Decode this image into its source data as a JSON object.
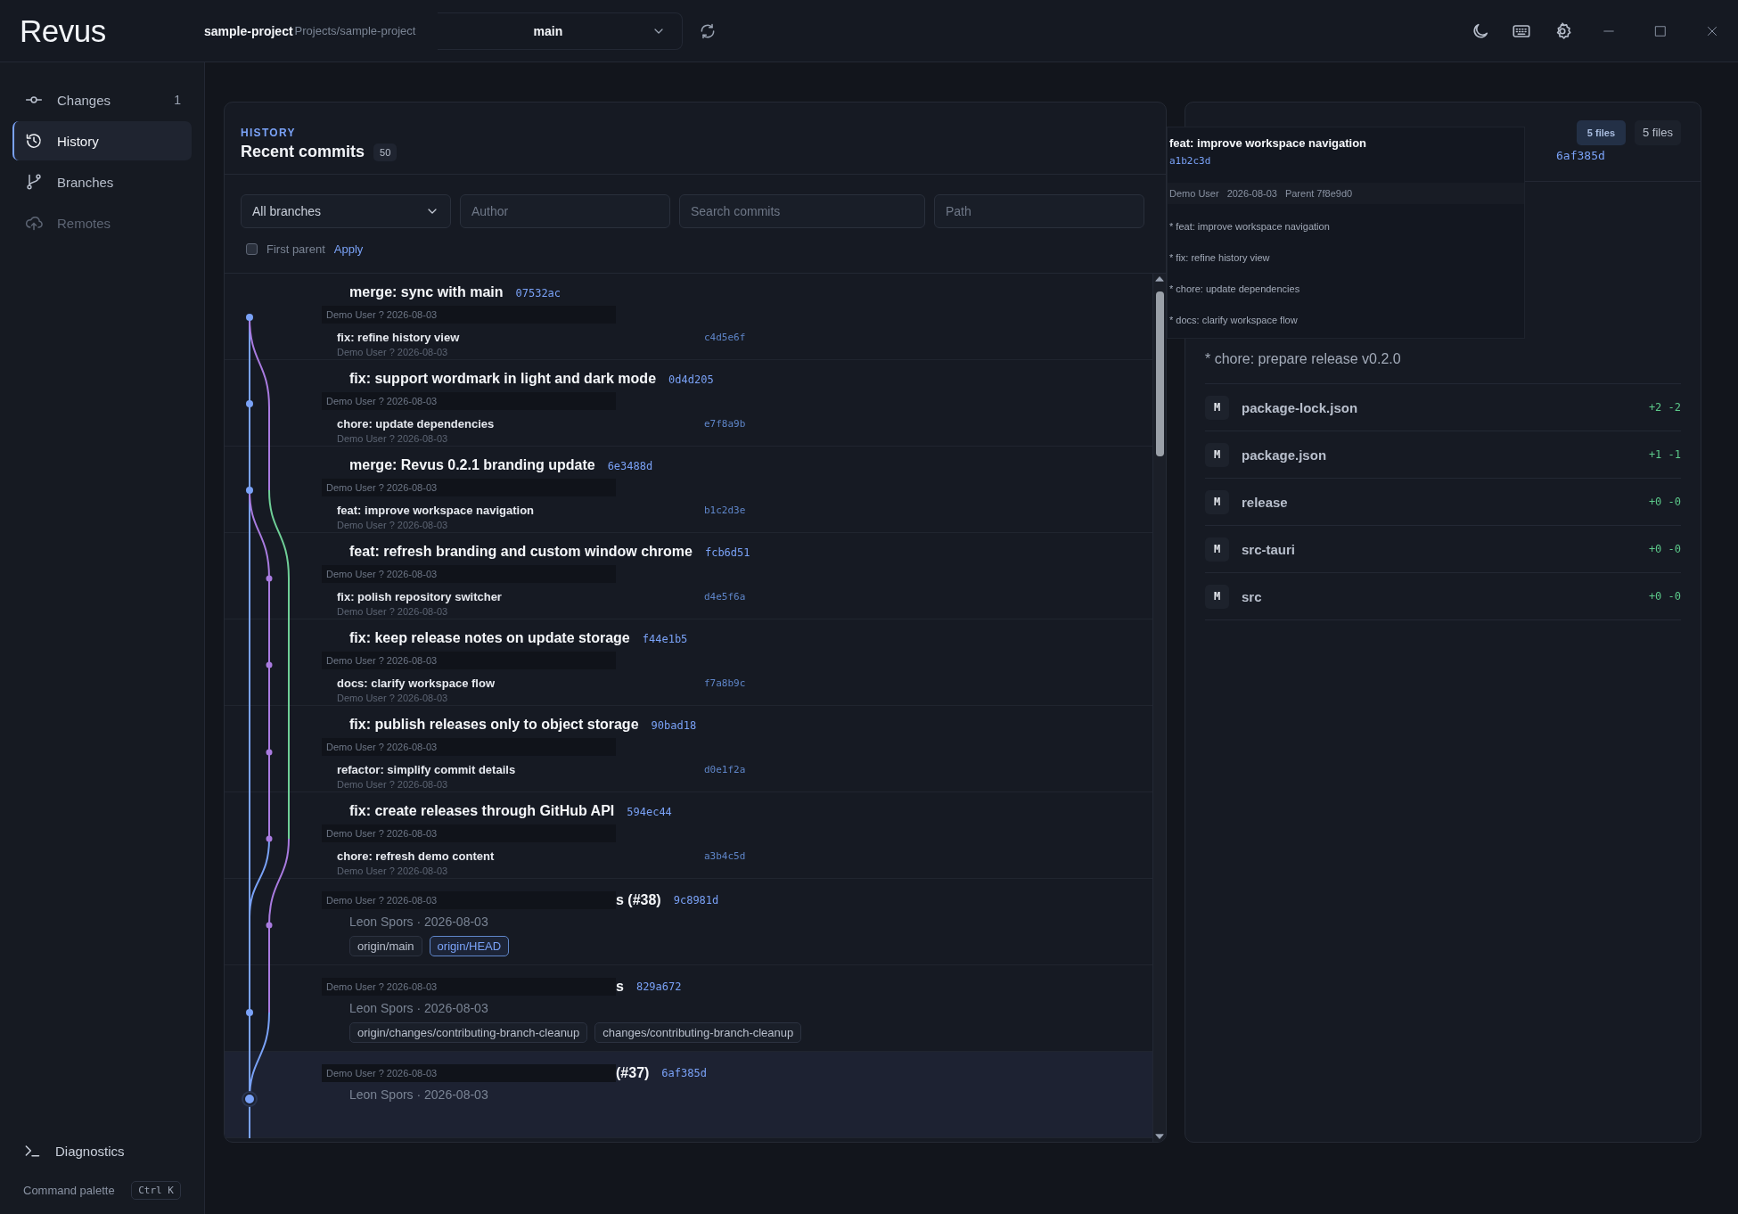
{
  "window": {
    "logo": "Revus",
    "repo_name": "sample-project",
    "repo_path": "Projects/sample-project",
    "branch": "main"
  },
  "sidebar": {
    "items": [
      {
        "label": "Changes",
        "count": "1",
        "selected": false,
        "disabled": false
      },
      {
        "label": "History",
        "selected": true,
        "disabled": false
      },
      {
        "label": "Branches",
        "selected": false,
        "disabled": false
      },
      {
        "label": "Remotes",
        "selected": false,
        "disabled": true
      }
    ],
    "diagnostics": "Diagnostics",
    "command_palette": "Command palette",
    "shortcut": "Ctrl K"
  },
  "history": {
    "eyebrow": "HISTORY",
    "title": "Recent commits",
    "count": "50",
    "branch_filter": "All branches",
    "author_placeholder": "Author",
    "search_placeholder": "Search commits",
    "path_placeholder": "Path",
    "first_parent": {
      "label": "First parent",
      "checked": false
    },
    "apply": "Apply",
    "commits": [
      {
        "kind": "full",
        "title": "merge: sync with main",
        "hash": "07532ac",
        "meta": "Demo User ? 2026-08-03",
        "selected": false,
        "sub": {
          "title": "fix: refine history view",
          "hash": "c4d5e6f",
          "meta": "Demo User ? 2026-08-03"
        }
      },
      {
        "kind": "full",
        "title": "fix: support wordmark in light and dark mode",
        "hash": "0d4d205",
        "meta": "Demo User ? 2026-08-03",
        "selected": false,
        "sub": {
          "title": "chore: update dependencies",
          "hash": "e7f8a9b",
          "meta": "Demo User ? 2026-08-03"
        }
      },
      {
        "kind": "full",
        "title": "merge: Revus 0.2.1 branding update",
        "hash": "6e3488d",
        "meta": "Demo User ? 2026-08-03",
        "selected": false,
        "sub": {
          "title": "feat: improve workspace navigation",
          "hash": "b1c2d3e",
          "meta": "Demo User ? 2026-08-03"
        }
      },
      {
        "kind": "full",
        "title": "feat: refresh branding and custom window chrome",
        "hash": "fcb6d51",
        "meta": "Demo User ? 2026-08-03",
        "selected": false,
        "sub": {
          "title": "fix: polish repository switcher",
          "hash": "d4e5f6a",
          "meta": "Demo User ? 2026-08-03"
        }
      },
      {
        "kind": "full",
        "title": "fix: keep release notes on update storage",
        "hash": "f44e1b5",
        "meta": "Demo User ? 2026-08-03",
        "selected": false,
        "sub": {
          "title": "docs: clarify workspace flow",
          "hash": "f7a8b9c",
          "meta": "Demo User ? 2026-08-03"
        }
      },
      {
        "kind": "full",
        "title": "fix: publish releases only to object storage",
        "hash": "90bad18",
        "meta": "Demo User ? 2026-08-03",
        "selected": false,
        "sub": {
          "title": "refactor: simplify commit details",
          "hash": "d0e1f2a",
          "meta": "Demo User ? 2026-08-03"
        }
      },
      {
        "kind": "full",
        "title": "fix: create releases through GitHub API",
        "hash": "594ec44",
        "meta": "Demo User ? 2026-08-03",
        "selected": false,
        "sub": {
          "title": "chore: refresh demo content",
          "hash": "a3b4c5d",
          "meta": "Demo User ? 2026-08-03"
        }
      },
      {
        "kind": "covered",
        "title": "s (#38)",
        "hash": "9c8981d",
        "meta": "Demo User ? 2026-08-03",
        "selected": false,
        "author": "Leon Spors · 2026-08-03",
        "tags": [
          {
            "label": "origin/main",
            "highlighted": false
          },
          {
            "label": "origin/HEAD",
            "highlighted": true
          }
        ]
      },
      {
        "kind": "covered",
        "title": "s",
        "hash": "829a672",
        "meta": "Demo User ? 2026-08-03",
        "selected": false,
        "author": "Leon Spors · 2026-08-03",
        "tags": [
          {
            "label": "origin/changes/contributing-branch-cleanup",
            "highlighted": false
          },
          {
            "label": "changes/contributing-branch-cleanup",
            "highlighted": false
          }
        ]
      },
      {
        "kind": "covered",
        "title": "(#37)",
        "hash": "6af385d",
        "meta": "Demo User ? 2026-08-03",
        "selected": true,
        "author": "Leon Spors · 2026-08-03"
      }
    ]
  },
  "details": {
    "tabs": [
      {
        "label": "5 files",
        "selected": true
      },
      {
        "label": "5 files",
        "selected": false
      }
    ],
    "hash": "6af385d",
    "message": "* chore: prepare release v0.2.0",
    "files": [
      {
        "status": "M",
        "name": "package-lock.json",
        "stat": "+2 -2"
      },
      {
        "status": "M",
        "name": "package.json",
        "stat": "+1 -1"
      },
      {
        "status": "M",
        "name": "release",
        "stat": "+0 -0"
      },
      {
        "status": "M",
        "name": "src-tauri",
        "stat": "+0 -0"
      },
      {
        "status": "M",
        "name": "src",
        "stat": "+0 -0"
      }
    ],
    "popup": {
      "title": "feat: improve workspace navigation",
      "hash": "a1b2c3d",
      "author": "Demo User",
      "date": "2026-08-03",
      "parent": "Parent 7f8e9d0",
      "lines": [
        "* feat: improve workspace navigation",
        "* fix: refine history view",
        "* chore: update dependencies",
        "* docs: clarify workspace flow"
      ]
    }
  }
}
